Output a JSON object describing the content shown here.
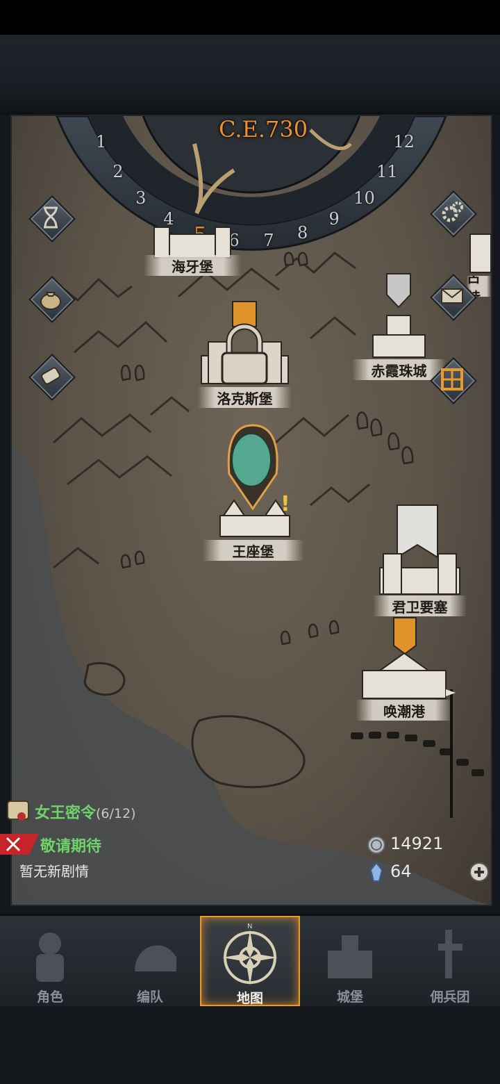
{
  "calendar": {
    "year": "C.E.730",
    "months": [
      "1",
      "2",
      "3",
      "4",
      "5",
      "6",
      "7",
      "8",
      "9",
      "10",
      "11",
      "12"
    ],
    "current_month": "5"
  },
  "locations": [
    {
      "name": "海牙堡"
    },
    {
      "name": "洛克斯堡"
    },
    {
      "name": "赤霞珠城"
    },
    {
      "name": "王座堡"
    },
    {
      "name": "君卫要塞"
    },
    {
      "name": "唤潮港"
    },
    {
      "name": "古特"
    }
  ],
  "side_buttons": [
    {
      "icon": "hourglass-icon"
    },
    {
      "icon": "money-bag-icon"
    },
    {
      "icon": "scroll-icon"
    },
    {
      "icon": "gear-icon"
    },
    {
      "icon": "mail-icon"
    },
    {
      "icon": "grid-icon"
    }
  ],
  "quest": {
    "title": "女王密令",
    "progress": "(6/12)",
    "stay_tuned": "敬请期待",
    "no_news": "暂无新剧情"
  },
  "resources": {
    "silver": "14921",
    "crystal": "64"
  },
  "tabs": [
    {
      "label": "角色"
    },
    {
      "label": "编队"
    },
    {
      "label": "地图"
    },
    {
      "label": "城堡"
    },
    {
      "label": "佣兵团"
    }
  ],
  "colors": {
    "accent": "#e89a2a",
    "quest_green": "#6fd36a",
    "year_orange": "#f0902a"
  }
}
